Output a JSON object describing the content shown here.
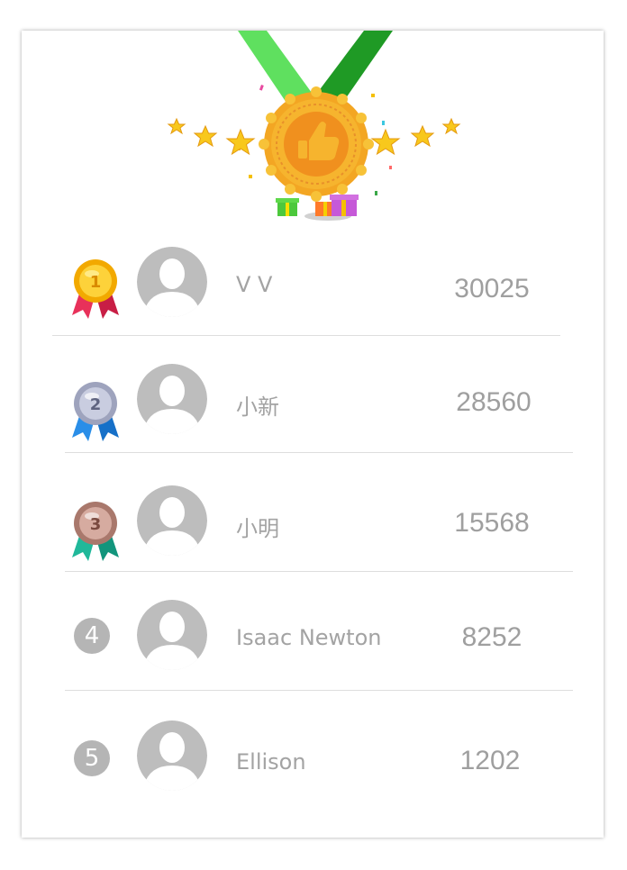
{
  "leaderboard": {
    "rows": [
      {
        "rank": "1",
        "rank_style": "gold-medal",
        "name": "V V",
        "score": "30025"
      },
      {
        "rank": "2",
        "rank_style": "silver-medal",
        "name": "小新",
        "score": "28560"
      },
      {
        "rank": "3",
        "rank_style": "bronze-medal",
        "name": "小明",
        "score": "15568"
      },
      {
        "rank": "4",
        "rank_style": "grey-circle",
        "name": "Isaac Newton",
        "score": "8252"
      },
      {
        "rank": "5",
        "rank_style": "grey-circle",
        "name": "Ellison",
        "score": "1202"
      }
    ]
  },
  "header": {
    "icon": "thumbs-up-medal-icon",
    "decorations": [
      "star-icon",
      "gift-icon",
      "confetti"
    ]
  },
  "colors": {
    "gold": "#f5b800",
    "silver": "#b8bcd0",
    "bronze": "#b98577",
    "rank_circle": "#b5b5b5",
    "avatar": "#bdbdbd",
    "text": "#a3a3a3",
    "ribbon_light": "#5ee060",
    "ribbon_dark": "#1f9a25"
  }
}
